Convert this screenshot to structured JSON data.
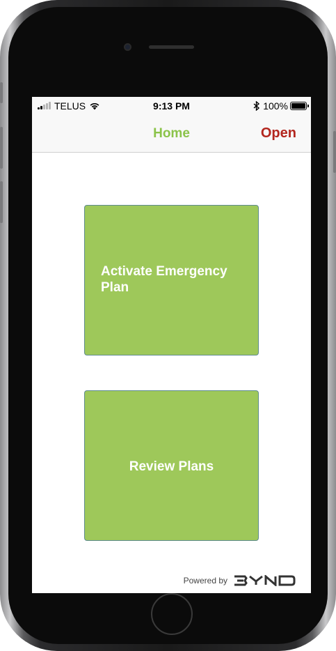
{
  "status_bar": {
    "carrier": "TELUS",
    "time": "9:13 PM",
    "battery": "100%"
  },
  "nav": {
    "title": "Home",
    "open_label": "Open"
  },
  "cards": {
    "activate_label": "Activate Emergency Plan",
    "review_label": "Review Plans"
  },
  "footer": {
    "powered_by": "Powered by",
    "logo_text": "BYND"
  },
  "colors": {
    "accent_green": "#9ec85a",
    "title_green": "#8bc34a",
    "open_red": "#b3261e"
  },
  "icons": {
    "signal": "cellular-signal-icon",
    "wifi": "wifi-icon",
    "bluetooth": "bluetooth-icon",
    "battery": "battery-icon"
  }
}
